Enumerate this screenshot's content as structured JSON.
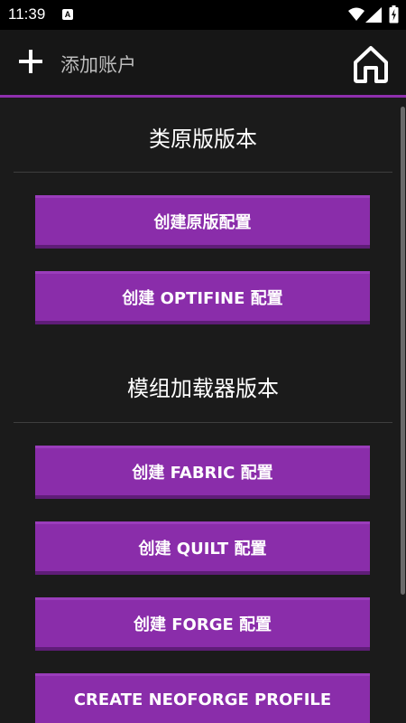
{
  "status_bar": {
    "time": "11:39",
    "notification_badge": "A",
    "icons": [
      "wifi-icon",
      "signal-icon",
      "battery-icon"
    ]
  },
  "toolbar": {
    "add_label": "添加账户",
    "add_icon": "plus-icon",
    "home_icon": "home-icon"
  },
  "sections": [
    {
      "title": "类原版版本",
      "buttons": [
        "创建原版配置",
        "创建 OPTIFINE 配置"
      ]
    },
    {
      "title": "模组加载器版本",
      "buttons": [
        "创建 FABRIC 配置",
        "创建 QUILT 配置",
        "创建 FORGE 配置",
        "CREATE NEOFORGE PROFILE"
      ]
    }
  ],
  "colors": {
    "accent": "#8e2fad",
    "button": "#8a2daa",
    "background": "#1b1b1b"
  }
}
